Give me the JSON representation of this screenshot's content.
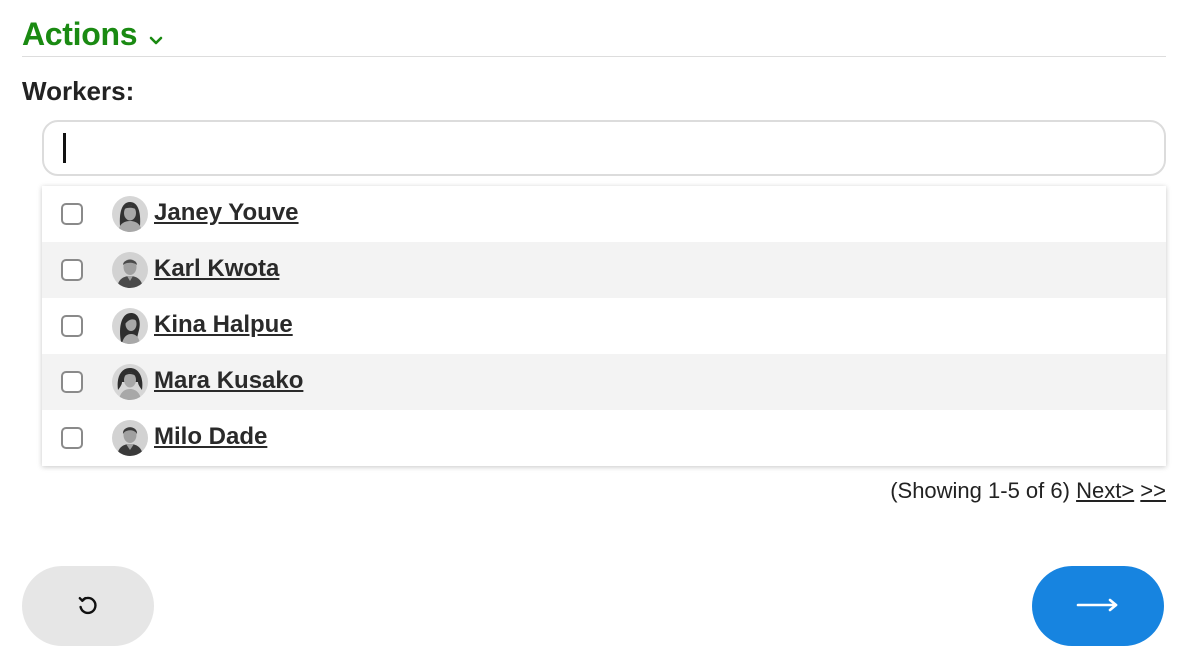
{
  "header": {
    "actions_label": "Actions",
    "actions_color": "#1a8a12"
  },
  "workers_label": "Workers:",
  "search": {
    "value": "",
    "placeholder": ""
  },
  "workers": [
    {
      "name": "Janey Youve",
      "checked": false,
      "avatar": "female-avatar-icon"
    },
    {
      "name": "Karl Kwota",
      "checked": false,
      "avatar": "male-avatar-icon"
    },
    {
      "name": "Kina Halpue",
      "checked": false,
      "avatar": "female-avatar-icon"
    },
    {
      "name": "Mara Kusako",
      "checked": false,
      "avatar": "female-avatar-icon"
    },
    {
      "name": "Milo Dade",
      "checked": false,
      "avatar": "male-avatar-icon"
    }
  ],
  "pagination": {
    "summary": "(Showing 1-5 of 6)",
    "next_label": "Next>",
    "last_label": ">>"
  },
  "buttons": {
    "reset_icon": "undo-icon",
    "next_icon": "arrow-right-icon",
    "next_color": "#1784e0"
  }
}
